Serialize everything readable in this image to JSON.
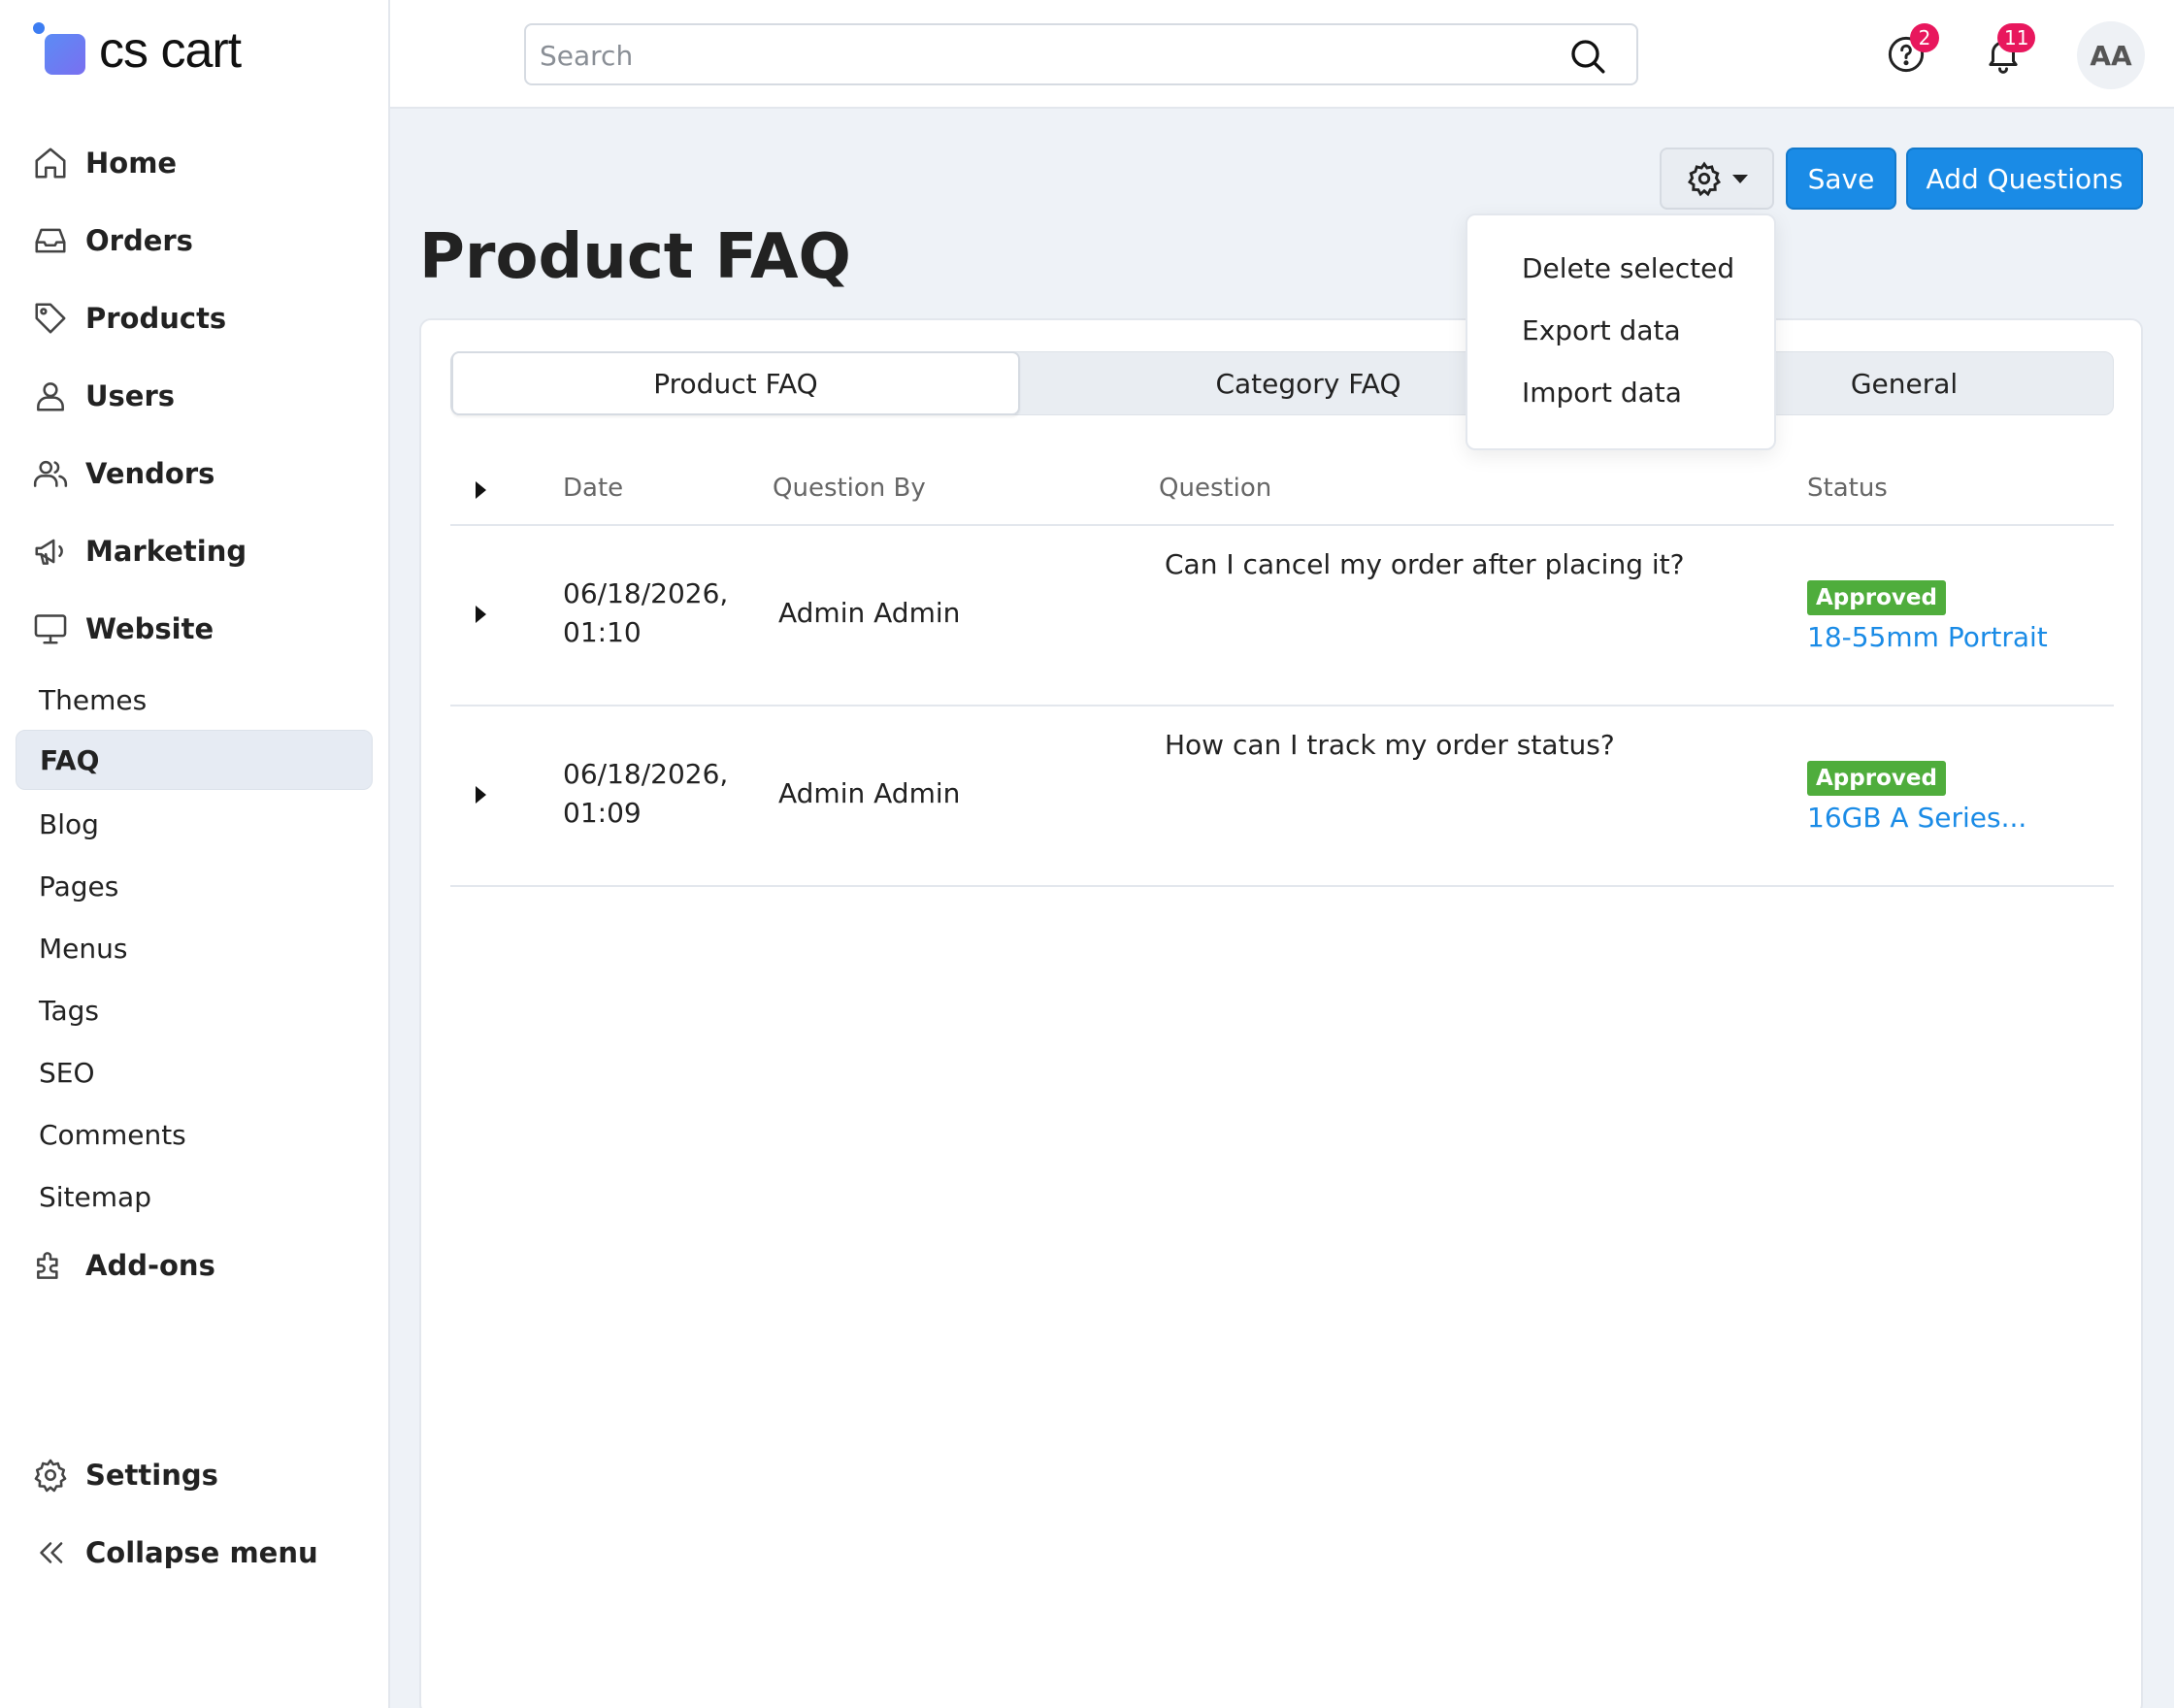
{
  "app": {
    "logo_text": "cs cart"
  },
  "sidebar": {
    "items": [
      {
        "label": "Home",
        "icon": "home-icon"
      },
      {
        "label": "Orders",
        "icon": "inbox-icon"
      },
      {
        "label": "Products",
        "icon": "tag-icon"
      },
      {
        "label": "Users",
        "icon": "user-icon"
      },
      {
        "label": "Vendors",
        "icon": "users-icon"
      },
      {
        "label": "Marketing",
        "icon": "megaphone-icon"
      },
      {
        "label": "Website",
        "icon": "monitor-icon"
      }
    ],
    "website_sub": [
      "Themes",
      "FAQ",
      "Blog",
      "Pages",
      "Menus",
      "Tags",
      "SEO",
      "Comments",
      "Sitemap"
    ],
    "active_sub": "FAQ",
    "addons": {
      "label": "Add-ons",
      "icon": "puzzle-icon"
    },
    "settings": {
      "label": "Settings",
      "icon": "gear-icon"
    },
    "collapse": {
      "label": "Collapse menu",
      "icon": "double-chevron-left-icon"
    }
  },
  "header": {
    "search_placeholder": "Search",
    "help_badge": "2",
    "notifications_badge": "11",
    "avatar_initials": "AA"
  },
  "page": {
    "title": "Product FAQ",
    "save_label": "Save",
    "add_label": "Add Questions"
  },
  "gear_menu": {
    "items": [
      "Delete selected",
      "Export data",
      "Import data"
    ]
  },
  "tabs": [
    {
      "label": "Product FAQ",
      "active": true
    },
    {
      "label": "Category FAQ",
      "active": false
    },
    {
      "label": "General",
      "active": false
    }
  ],
  "table": {
    "columns": [
      "Date",
      "Question By",
      "Question",
      "Status"
    ],
    "rows": [
      {
        "date_line1": "06/18/2026,",
        "date_line2": "01:10",
        "by": "Admin Admin",
        "question": "Can I cancel my order after placing it?",
        "status": "Approved",
        "product": "18-55mm Portrait"
      },
      {
        "date_line1": "06/18/2026,",
        "date_line2": "01:09",
        "by": "Admin Admin",
        "question": "How can I track my order status?",
        "status": "Approved",
        "product": "16GB A Series..."
      }
    ]
  },
  "colors": {
    "primary": "#1a8be6",
    "approved": "#4fad3c",
    "badge": "#e8175d"
  }
}
